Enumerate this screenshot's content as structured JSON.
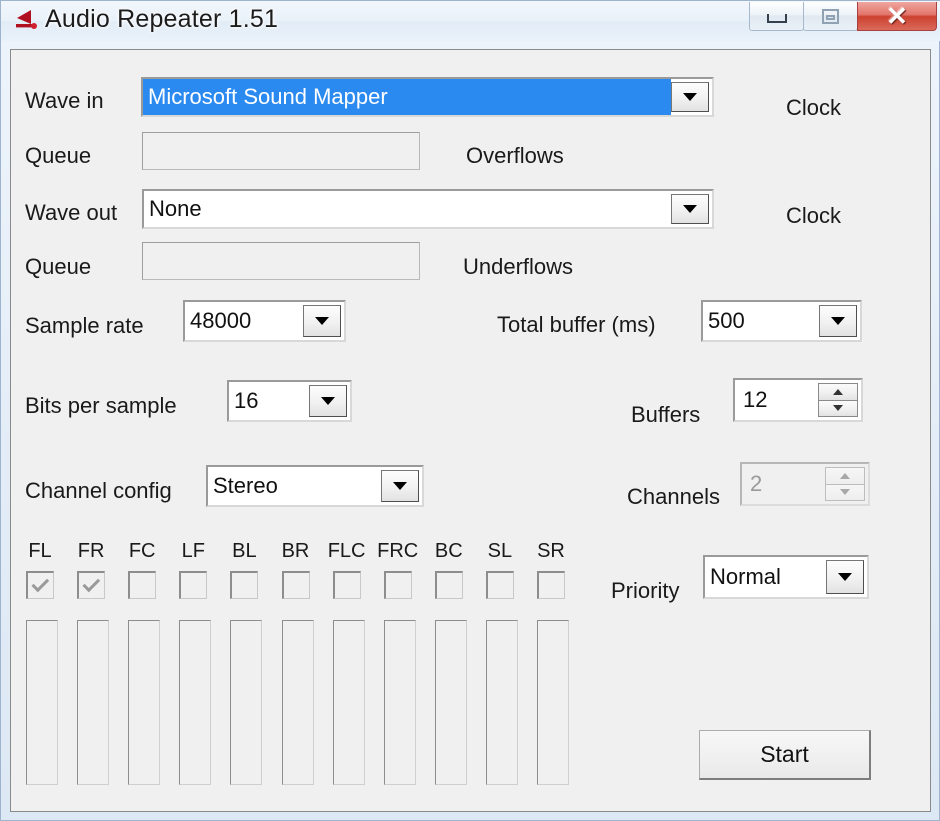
{
  "window": {
    "title": "Audio Repeater 1.51",
    "app_icon": "red-arrow-speaker-icon",
    "controls": {
      "minimize": "minimize-button",
      "maximize": "maximize-button",
      "close": "close-button",
      "close_glyph": "✕"
    },
    "accent_close": "#cc4130",
    "accent_selection": "#2a8af0"
  },
  "form": {
    "wave_in": {
      "label": "Wave in",
      "value": "Microsoft Sound Mapper",
      "selected": true,
      "clock_label": "Clock"
    },
    "queue_in": {
      "label": "Queue",
      "value": "",
      "counter_label": "Overflows"
    },
    "wave_out": {
      "label": "Wave out",
      "value": "None",
      "selected": false,
      "clock_label": "Clock"
    },
    "queue_out": {
      "label": "Queue",
      "value": "",
      "counter_label": "Underflows"
    },
    "sample_rate": {
      "label": "Sample rate",
      "value": "48000"
    },
    "total_buffer": {
      "label": "Total buffer (ms)",
      "value": "500"
    },
    "bits_per_sample": {
      "label": "Bits per sample",
      "value": "16"
    },
    "buffers": {
      "label": "Buffers",
      "value": "12",
      "disabled": false
    },
    "channel_config": {
      "label": "Channel config",
      "value": "Stereo"
    },
    "channels": {
      "label": "Channels",
      "value": "2",
      "disabled": true
    },
    "priority": {
      "label": "Priority",
      "value": "Normal"
    }
  },
  "channels": [
    {
      "label": "FL",
      "checked": true
    },
    {
      "label": "FR",
      "checked": true
    },
    {
      "label": "FC",
      "checked": false
    },
    {
      "label": "LF",
      "checked": false
    },
    {
      "label": "BL",
      "checked": false
    },
    {
      "label": "BR",
      "checked": false
    },
    {
      "label": "FLC",
      "checked": false
    },
    {
      "label": "FRC",
      "checked": false
    },
    {
      "label": "BC",
      "checked": false
    },
    {
      "label": "SL",
      "checked": false
    },
    {
      "label": "SR",
      "checked": false
    }
  ],
  "meters": [
    {
      "channel": "FL",
      "level": 0
    },
    {
      "channel": "FR",
      "level": 0
    },
    {
      "channel": "FC",
      "level": 0
    },
    {
      "channel": "LF",
      "level": 0
    },
    {
      "channel": "BL",
      "level": 0
    },
    {
      "channel": "BR",
      "level": 0
    },
    {
      "channel": "FLC",
      "level": 0
    },
    {
      "channel": "FRC",
      "level": 0
    },
    {
      "channel": "BC",
      "level": 0
    },
    {
      "channel": "SL",
      "level": 0
    },
    {
      "channel": "SR",
      "level": 0
    }
  ],
  "actions": {
    "start_label": "Start"
  }
}
